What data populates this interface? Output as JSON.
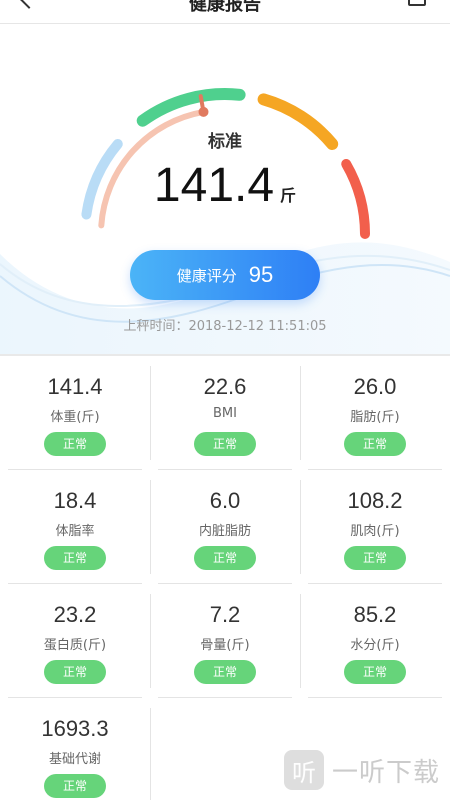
{
  "header": {
    "title": "健康报告"
  },
  "hero": {
    "status": "标准",
    "weight": "141.4",
    "unit": "斤",
    "score_label": "健康评分",
    "score": "95",
    "weigh_time": "上秤时间：2018-12-12 11:51:05",
    "colors": {
      "blue_arc": "#b9dcf6",
      "green_arc": "#4fd08e",
      "orange_arc": "#f5a623",
      "red_arc": "#f25f4c",
      "pointer": "#e07a5f",
      "progress_arc": "#f6c4b1"
    }
  },
  "metrics": [
    {
      "value": "141.4",
      "label": "体重(斤)",
      "badge": "正常"
    },
    {
      "value": "22.6",
      "label": "BMI",
      "badge": "正常"
    },
    {
      "value": "26.0",
      "label": "脂肪(斤)",
      "badge": "正常"
    },
    {
      "value": "18.4",
      "label": "体脂率",
      "badge": "正常"
    },
    {
      "value": "6.0",
      "label": "内脏脂肪",
      "badge": "正常"
    },
    {
      "value": "108.2",
      "label": "肌肉(斤)",
      "badge": "正常"
    },
    {
      "value": "23.2",
      "label": "蛋白质(斤)",
      "badge": "正常"
    },
    {
      "value": "7.2",
      "label": "骨量(斤)",
      "badge": "正常"
    },
    {
      "value": "85.2",
      "label": "水分(斤)",
      "badge": "正常"
    },
    {
      "value": "1693.3",
      "label": "基础代谢",
      "badge": "正常"
    }
  ],
  "badge_color": "#66d47a",
  "watermark": {
    "logo": "听",
    "text": "一听下载"
  }
}
